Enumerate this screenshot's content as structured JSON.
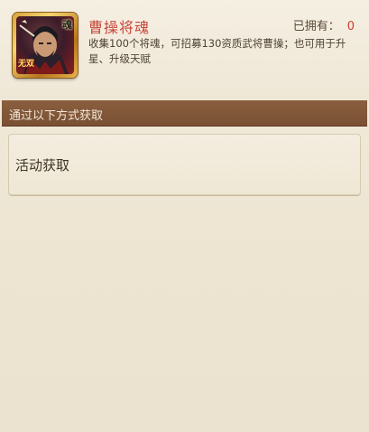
{
  "hero": {
    "name": "曹操将魂",
    "portrait_icon": "cao-cao-portrait",
    "badge_soul": "魂",
    "badge_wushuang": "无双",
    "owned_label": "已拥有：",
    "owned_count": "0",
    "description": "收集100个将魂，可招募130资质武将曹操；也可用于升星、升级天赋"
  },
  "section": {
    "title": "通过以下方式获取"
  },
  "sources": [
    {
      "label": "活动获取"
    }
  ],
  "colors": {
    "title_red": "#c7463b",
    "count_red": "#d23c30",
    "section_brown": "#7a5034",
    "panel_bg": "#efe7d6"
  }
}
